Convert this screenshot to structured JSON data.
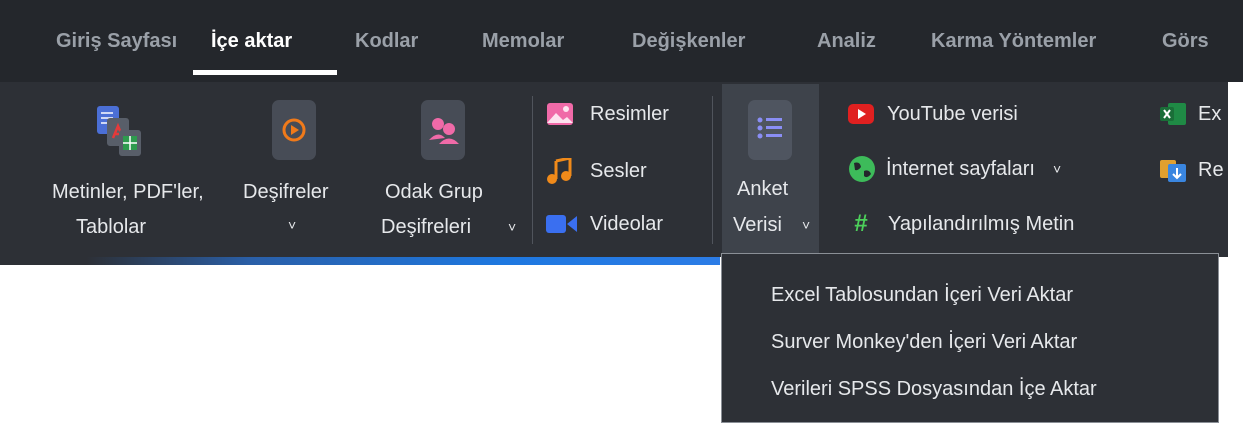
{
  "tabs": [
    {
      "label": "Giriş Sayfası",
      "active": false
    },
    {
      "label": "İçe aktar",
      "active": true
    },
    {
      "label": "Kodlar",
      "active": false
    },
    {
      "label": "Memolar",
      "active": false
    },
    {
      "label": "Değişkenler",
      "active": false
    },
    {
      "label": "Analiz",
      "active": false
    },
    {
      "label": "Karma Yöntemler",
      "active": false
    },
    {
      "label": "Görs",
      "active": false
    }
  ],
  "ribbon": {
    "texts": {
      "line1": "Metinler, PDF'ler,",
      "line2": "Tablolar",
      "icon": "documents-pdf-table-icon"
    },
    "transcripts": {
      "line1": "Deşifreler",
      "chevron": "˅",
      "icon": "play-file-icon",
      "icon_color": "#f07a1a"
    },
    "focus_group": {
      "line1": "Odak Grup",
      "line2": "Deşifreleri",
      "chevron": "˅",
      "icon": "group-file-icon",
      "icon_color": "#f06aa8"
    },
    "images": {
      "label": "Resimler",
      "icon": "image-icon",
      "icon_color": "#f06aa8"
    },
    "audio": {
      "label": "Sesler",
      "icon": "music-note-icon",
      "icon_color": "#f08a1a"
    },
    "video": {
      "label": "Videolar",
      "icon": "video-camera-icon",
      "icon_color": "#3a6ff0"
    },
    "survey": {
      "line1": "Anket",
      "line2": "Verisi",
      "chevron": "˅",
      "icon": "survey-list-icon",
      "icon_color": "#8a8ef5"
    },
    "youtube": {
      "label": "YouTube verisi",
      "icon": "youtube-icon",
      "icon_color": "#e02020"
    },
    "web": {
      "label": "İnternet sayfaları",
      "chevron": "˅",
      "icon": "globe-icon",
      "icon_color": "#3dbb5a"
    },
    "structured": {
      "label": "Yapılandırılmış Metin",
      "icon": "hash-icon",
      "icon_color": "#4ccf5a"
    },
    "excel": {
      "label": "Ex",
      "icon": "excel-icon",
      "icon_color": "#1f8a45"
    },
    "ref": {
      "label": "Re",
      "icon": "reference-import-icon",
      "icon_color": "#3a86e0"
    }
  },
  "dropdown": {
    "items": [
      "Excel Tablosundan İçeri Veri Aktar",
      "Surver Monkey'den İçeri Veri Aktar",
      "Verileri SPSS Dosyasından İçe Aktar"
    ]
  }
}
